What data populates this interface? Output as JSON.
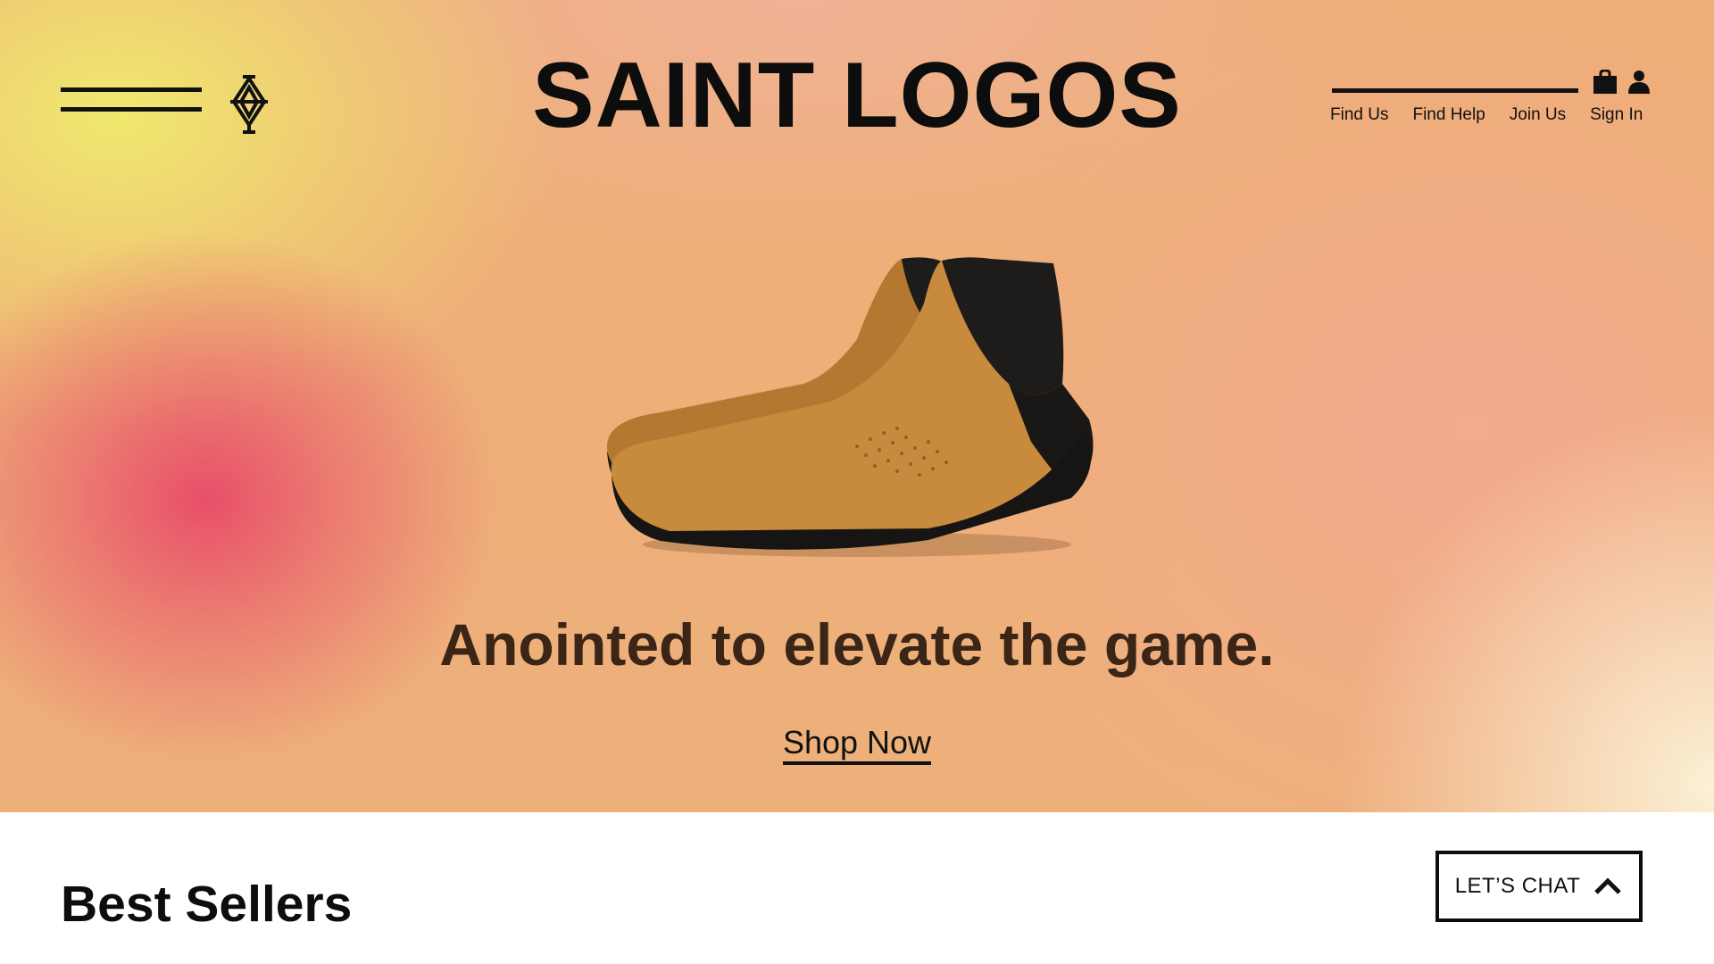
{
  "header": {
    "brand": "SAINT LOGOS",
    "menu_icon": "hamburger-menu-icon",
    "emblem_icon": "diamond-cross-emblem-icon",
    "search_icon": "search-line-icon",
    "bag_icon": "shopping-bag-icon",
    "user_icon": "user-icon",
    "nav": [
      {
        "label": "Find Us"
      },
      {
        "label": "Find Help"
      },
      {
        "label": "Join Us"
      },
      {
        "label": "Sign In"
      }
    ]
  },
  "hero": {
    "image": "tan-leather-sneaker-boots",
    "tagline": "Anointed to elevate the game.",
    "cta": "Shop Now",
    "colors": {
      "pink": "#e84a68",
      "yellow": "#f0ec6e",
      "peach": "#eeae76",
      "cream": "#fcf4da"
    }
  },
  "main": {
    "section_title": "Best Sellers"
  },
  "chat": {
    "label": "LET’S CHAT",
    "icon": "chevron-up-icon"
  }
}
